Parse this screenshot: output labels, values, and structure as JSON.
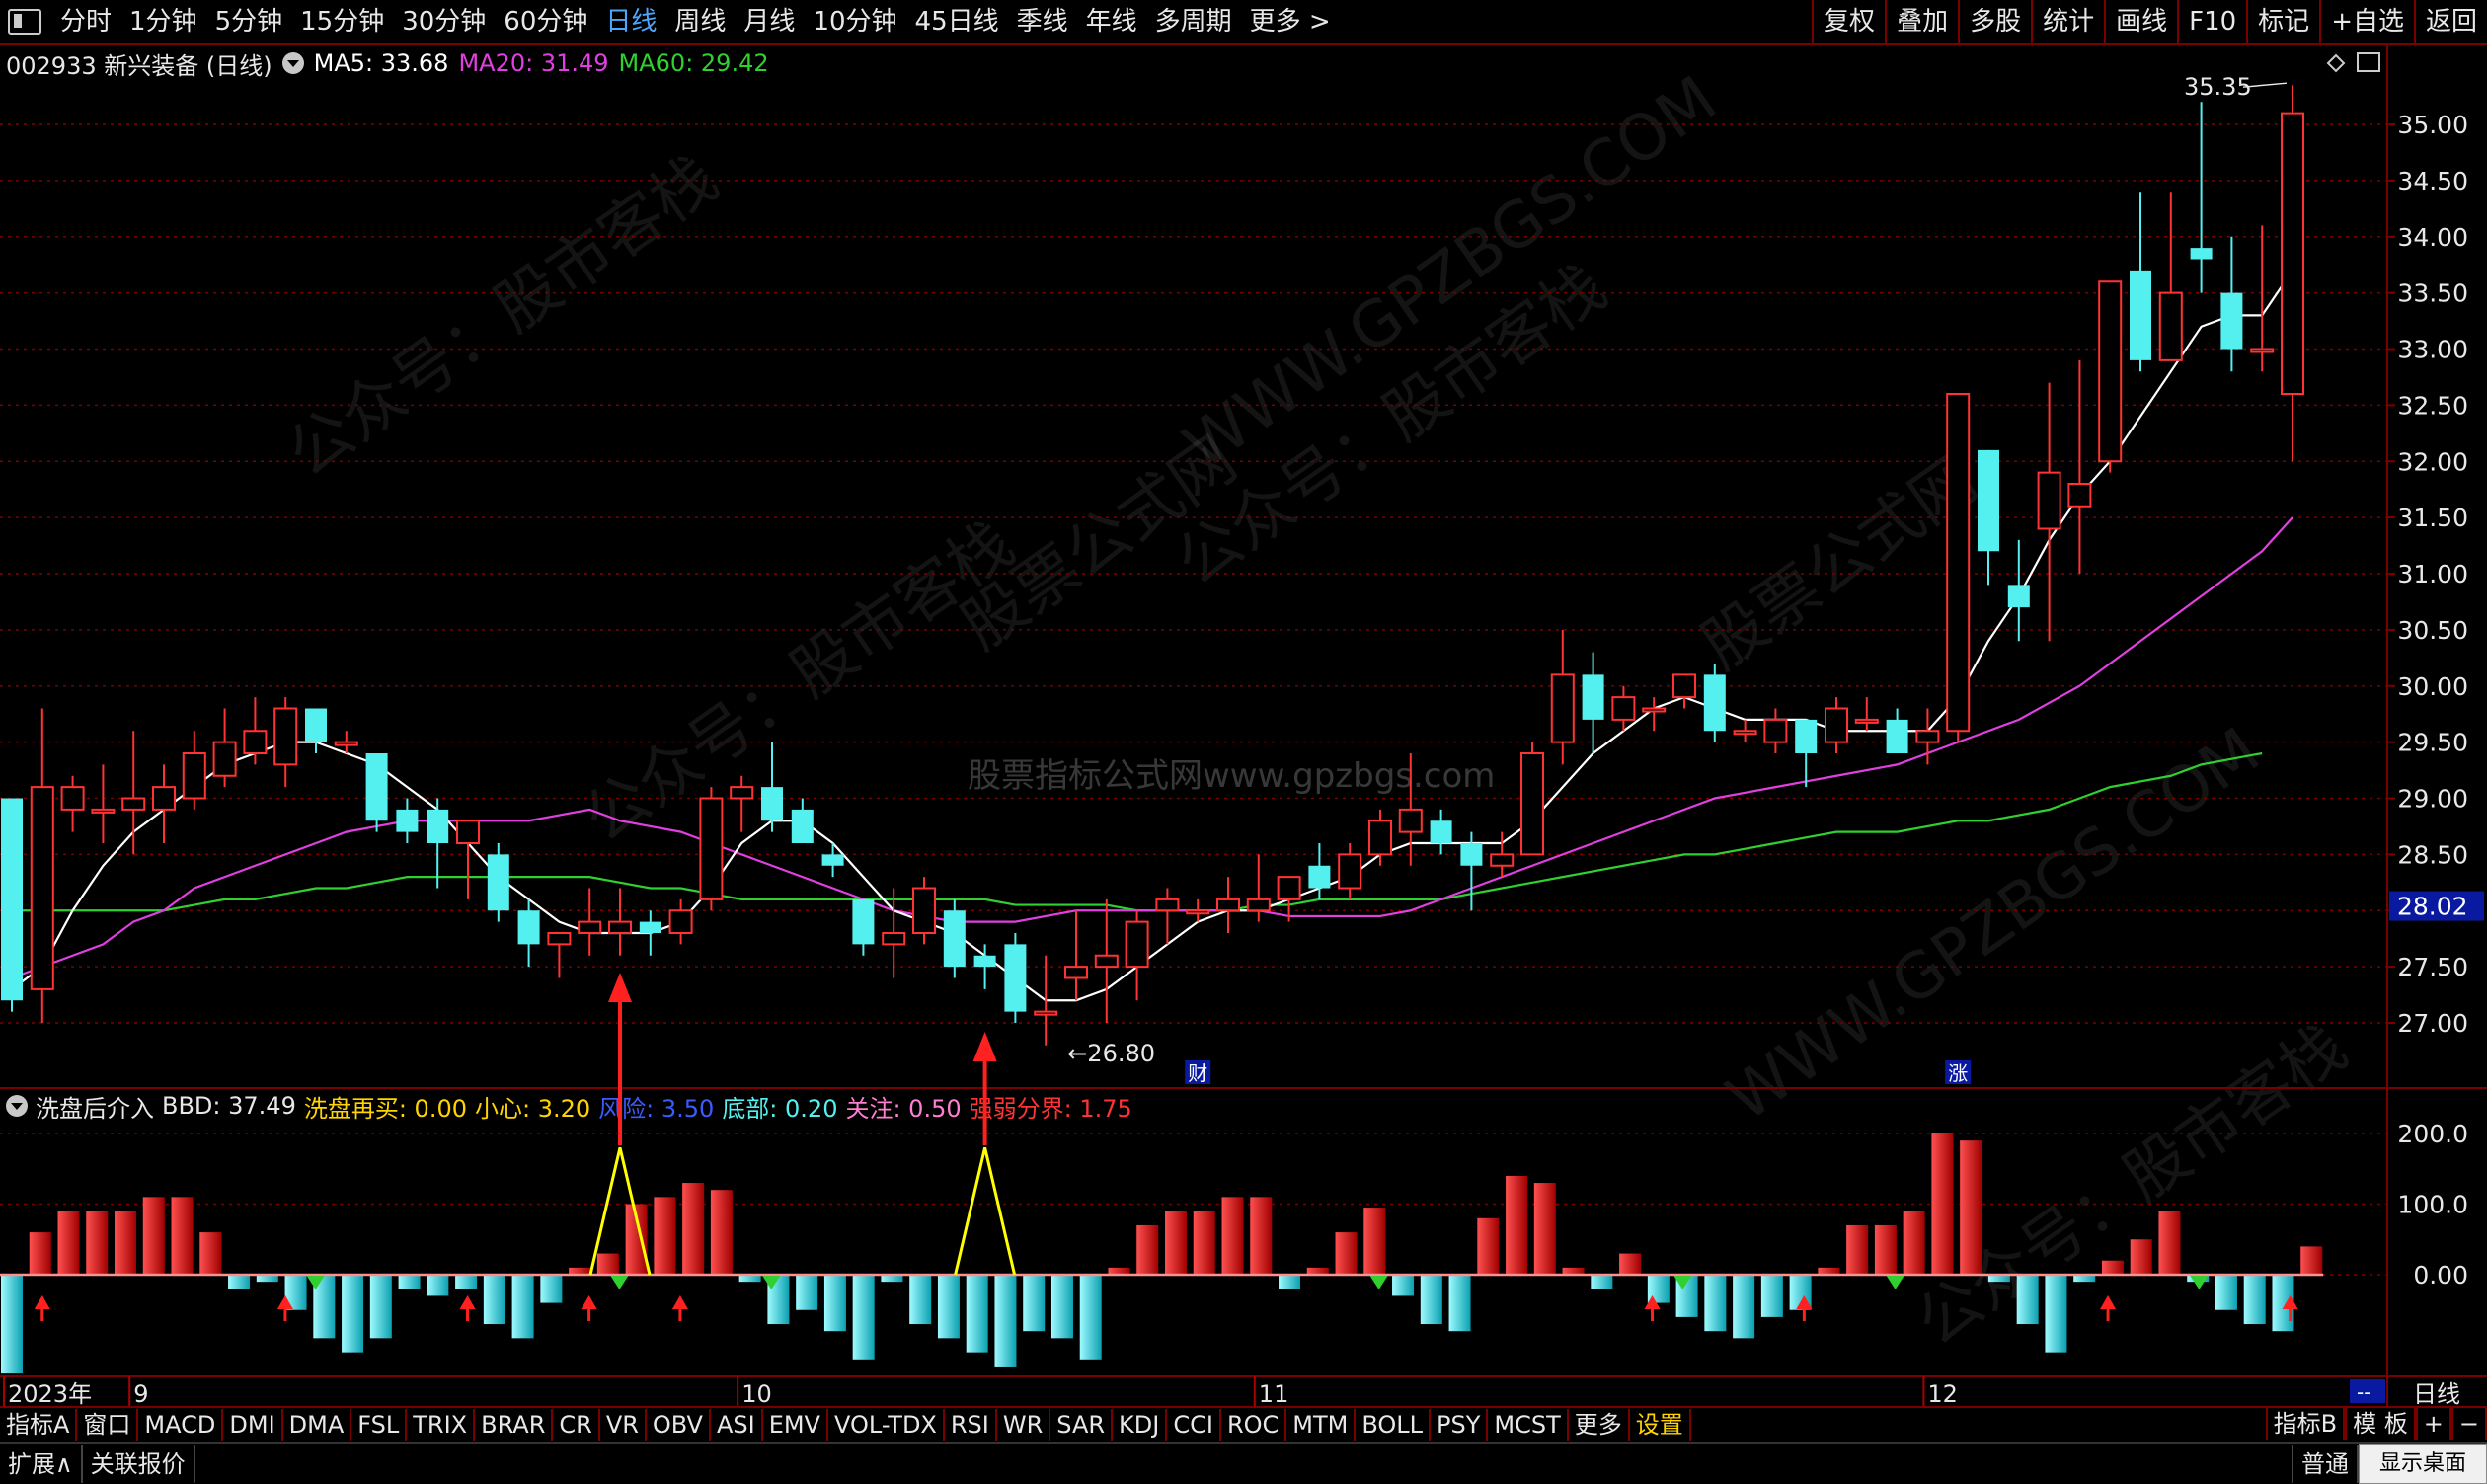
{
  "toolbar": {
    "periods": [
      "分时",
      "1分钟",
      "5分钟",
      "15分钟",
      "30分钟",
      "60分钟",
      "日线",
      "周线",
      "月线",
      "10分钟",
      "45日线",
      "季线",
      "年线",
      "多周期",
      "更多 >"
    ],
    "active_period": "日线",
    "right_items": [
      "复权",
      "叠加",
      "多股",
      "统计",
      "画线",
      "F10",
      "标记",
      "+自选",
      "返回"
    ]
  },
  "stock": {
    "code_name": "002933 新兴装备 (日线)",
    "ma5": "MA5: 33.68",
    "ma20": "MA20: 31.49",
    "ma60": "MA60: 29.42"
  },
  "indicator": {
    "name": "洗盘后介入",
    "bbd": "BBD: 37.49",
    "xpzm": "洗盘再买: 0.00",
    "xx": "小心: 3.20",
    "fx": "风险: 3.50",
    "db": "底部: 0.20",
    "gz": "关注: 0.50",
    "qrfj": "强弱分界: 1.75"
  },
  "colors": {
    "up": "#ff3333",
    "down": "#54f0f0",
    "ma5": "#ffffff",
    "ma20": "#e040e0",
    "ma60": "#30d030",
    "grid": "#7a0000",
    "axis_text": "#e8e8e8"
  },
  "chart_data": {
    "type": "candlestick",
    "price_axis": [
      27.0,
      27.5,
      28.0,
      28.5,
      29.0,
      29.5,
      30.0,
      30.5,
      31.0,
      31.5,
      32.0,
      32.5,
      33.0,
      33.5,
      34.0,
      34.5,
      35.0
    ],
    "price_axis_labels": [
      "27.00",
      "27.50",
      "28.00",
      "28.50",
      "29.00",
      "29.50",
      "30.00",
      "30.50",
      "31.00",
      "31.50",
      "32.00",
      "32.50",
      "33.00",
      "33.50",
      "34.00",
      "34.50",
      "35.00"
    ],
    "current_price_label": "28.02",
    "max_label": "35.35",
    "min_label": "26.80",
    "markers": [
      {
        "text": "财",
        "index": 39
      },
      {
        "text": "涨",
        "index": 64
      }
    ],
    "candles": [
      {
        "o": 29.0,
        "h": 29.0,
        "l": 27.1,
        "c": 27.2
      },
      {
        "o": 27.3,
        "h": 29.8,
        "l": 27.0,
        "c": 29.1
      },
      {
        "o": 28.9,
        "h": 29.2,
        "l": 28.7,
        "c": 29.1
      },
      {
        "o": 28.9,
        "h": 29.3,
        "l": 28.6,
        "c": 28.9
      },
      {
        "o": 28.9,
        "h": 29.6,
        "l": 28.5,
        "c": 29.0
      },
      {
        "o": 28.9,
        "h": 29.3,
        "l": 28.6,
        "c": 29.1
      },
      {
        "o": 29.0,
        "h": 29.6,
        "l": 28.9,
        "c": 29.4
      },
      {
        "o": 29.2,
        "h": 29.8,
        "l": 29.1,
        "c": 29.5
      },
      {
        "o": 29.4,
        "h": 29.9,
        "l": 29.3,
        "c": 29.6
      },
      {
        "o": 29.3,
        "h": 29.9,
        "l": 29.1,
        "c": 29.8
      },
      {
        "o": 29.8,
        "h": 29.8,
        "l": 29.4,
        "c": 29.5
      },
      {
        "o": 29.5,
        "h": 29.6,
        "l": 29.4,
        "c": 29.5
      },
      {
        "o": 29.4,
        "h": 29.4,
        "l": 28.7,
        "c": 28.8
      },
      {
        "o": 28.9,
        "h": 29.0,
        "l": 28.6,
        "c": 28.7
      },
      {
        "o": 28.9,
        "h": 29.0,
        "l": 28.2,
        "c": 28.6
      },
      {
        "o": 28.6,
        "h": 28.8,
        "l": 28.1,
        "c": 28.8
      },
      {
        "o": 28.5,
        "h": 28.6,
        "l": 27.9,
        "c": 28.0
      },
      {
        "o": 28.0,
        "h": 28.1,
        "l": 27.5,
        "c": 27.7
      },
      {
        "o": 27.7,
        "h": 27.8,
        "l": 27.4,
        "c": 27.8
      },
      {
        "o": 27.8,
        "h": 28.2,
        "l": 27.6,
        "c": 27.9
      },
      {
        "o": 27.8,
        "h": 28.2,
        "l": 27.6,
        "c": 27.9
      },
      {
        "o": 27.9,
        "h": 28.0,
        "l": 27.6,
        "c": 27.8
      },
      {
        "o": 27.8,
        "h": 28.1,
        "l": 27.7,
        "c": 28.0
      },
      {
        "o": 28.1,
        "h": 29.1,
        "l": 28.0,
        "c": 29.0
      },
      {
        "o": 29.0,
        "h": 29.2,
        "l": 28.7,
        "c": 29.1
      },
      {
        "o": 29.1,
        "h": 29.5,
        "l": 28.7,
        "c": 28.8
      },
      {
        "o": 28.9,
        "h": 29.0,
        "l": 28.6,
        "c": 28.6
      },
      {
        "o": 28.5,
        "h": 28.6,
        "l": 28.3,
        "c": 28.4
      },
      {
        "o": 28.1,
        "h": 28.1,
        "l": 27.6,
        "c": 27.7
      },
      {
        "o": 27.7,
        "h": 28.2,
        "l": 27.4,
        "c": 27.8
      },
      {
        "o": 27.8,
        "h": 28.3,
        "l": 27.7,
        "c": 28.2
      },
      {
        "o": 28.0,
        "h": 28.1,
        "l": 27.4,
        "c": 27.5
      },
      {
        "o": 27.6,
        "h": 27.7,
        "l": 27.3,
        "c": 27.5
      },
      {
        "o": 27.7,
        "h": 27.8,
        "l": 27.0,
        "c": 27.1
      },
      {
        "o": 27.1,
        "h": 27.6,
        "l": 26.8,
        "c": 27.1
      },
      {
        "o": 27.4,
        "h": 28.0,
        "l": 27.2,
        "c": 27.5
      },
      {
        "o": 27.5,
        "h": 28.1,
        "l": 27.0,
        "c": 27.6
      },
      {
        "o": 27.5,
        "h": 28.0,
        "l": 27.2,
        "c": 27.9
      },
      {
        "o": 28.0,
        "h": 28.2,
        "l": 27.7,
        "c": 28.1
      },
      {
        "o": 28.0,
        "h": 28.1,
        "l": 27.9,
        "c": 28.0
      },
      {
        "o": 28.0,
        "h": 28.3,
        "l": 27.8,
        "c": 28.1
      },
      {
        "o": 28.0,
        "h": 28.5,
        "l": 27.9,
        "c": 28.1
      },
      {
        "o": 28.1,
        "h": 28.3,
        "l": 27.9,
        "c": 28.3
      },
      {
        "o": 28.4,
        "h": 28.6,
        "l": 28.1,
        "c": 28.2
      },
      {
        "o": 28.2,
        "h": 28.6,
        "l": 28.1,
        "c": 28.5
      },
      {
        "o": 28.5,
        "h": 28.9,
        "l": 28.4,
        "c": 28.8
      },
      {
        "o": 28.7,
        "h": 29.4,
        "l": 28.4,
        "c": 28.9
      },
      {
        "o": 28.8,
        "h": 28.9,
        "l": 28.5,
        "c": 28.6
      },
      {
        "o": 28.6,
        "h": 28.7,
        "l": 28.0,
        "c": 28.4
      },
      {
        "o": 28.4,
        "h": 28.7,
        "l": 28.3,
        "c": 28.5
      },
      {
        "o": 28.5,
        "h": 29.5,
        "l": 28.5,
        "c": 29.4
      },
      {
        "o": 29.5,
        "h": 30.5,
        "l": 29.3,
        "c": 30.1
      },
      {
        "o": 30.1,
        "h": 30.3,
        "l": 29.4,
        "c": 29.7
      },
      {
        "o": 29.7,
        "h": 30.0,
        "l": 29.6,
        "c": 29.9
      },
      {
        "o": 29.8,
        "h": 29.9,
        "l": 29.6,
        "c": 29.8
      },
      {
        "o": 29.9,
        "h": 30.1,
        "l": 29.8,
        "c": 30.1
      },
      {
        "o": 30.1,
        "h": 30.2,
        "l": 29.5,
        "c": 29.6
      },
      {
        "o": 29.6,
        "h": 29.7,
        "l": 29.5,
        "c": 29.6
      },
      {
        "o": 29.5,
        "h": 29.8,
        "l": 29.4,
        "c": 29.7
      },
      {
        "o": 29.7,
        "h": 29.7,
        "l": 29.1,
        "c": 29.4
      },
      {
        "o": 29.5,
        "h": 29.9,
        "l": 29.4,
        "c": 29.8
      },
      {
        "o": 29.7,
        "h": 29.9,
        "l": 29.6,
        "c": 29.7
      },
      {
        "o": 29.7,
        "h": 29.8,
        "l": 29.5,
        "c": 29.4
      },
      {
        "o": 29.5,
        "h": 29.8,
        "l": 29.3,
        "c": 29.6
      },
      {
        "o": 29.6,
        "h": 32.6,
        "l": 29.5,
        "c": 32.6
      },
      {
        "o": 32.1,
        "h": 32.1,
        "l": 30.9,
        "c": 31.2
      },
      {
        "o": 30.9,
        "h": 31.3,
        "l": 30.4,
        "c": 30.7
      },
      {
        "o": 31.4,
        "h": 32.7,
        "l": 30.4,
        "c": 31.9
      },
      {
        "o": 31.6,
        "h": 32.9,
        "l": 31.0,
        "c": 31.8
      },
      {
        "o": 32.0,
        "h": 33.5,
        "l": 31.9,
        "c": 33.6
      },
      {
        "o": 33.7,
        "h": 34.4,
        "l": 32.8,
        "c": 32.9
      },
      {
        "o": 32.9,
        "h": 34.4,
        "l": 32.9,
        "c": 33.5
      },
      {
        "o": 33.9,
        "h": 35.2,
        "l": 33.5,
        "c": 33.8
      },
      {
        "o": 33.5,
        "h": 34.0,
        "l": 32.8,
        "c": 33.0
      },
      {
        "o": 33.0,
        "h": 34.1,
        "l": 32.8,
        "c": 33.0
      },
      {
        "o": 32.6,
        "h": 35.35,
        "l": 32.0,
        "c": 35.1
      }
    ],
    "ma5_values": [
      27.3,
      27.5,
      28.0,
      28.4,
      28.7,
      28.9,
      29.1,
      29.3,
      29.4,
      29.5,
      29.5,
      29.4,
      29.3,
      29.1,
      28.9,
      28.6,
      28.3,
      28.1,
      27.9,
      27.8,
      27.8,
      27.8,
      27.9,
      28.2,
      28.6,
      28.8,
      28.8,
      28.6,
      28.3,
      28.0,
      27.9,
      27.8,
      27.6,
      27.4,
      27.2,
      27.2,
      27.3,
      27.5,
      27.7,
      27.9,
      28.0,
      28.0,
      28.1,
      28.2,
      28.3,
      28.5,
      28.6,
      28.6,
      28.6,
      28.6,
      28.8,
      29.1,
      29.4,
      29.6,
      29.8,
      29.9,
      29.8,
      29.7,
      29.7,
      29.7,
      29.6,
      29.6,
      29.6,
      29.6,
      29.9,
      30.4,
      30.8,
      31.3,
      31.7,
      32.0,
      32.4,
      32.8,
      33.2,
      33.3,
      33.3,
      33.7
    ],
    "ma20_values": [
      27.4,
      27.5,
      27.6,
      27.7,
      27.9,
      28.0,
      28.2,
      28.3,
      28.4,
      28.5,
      28.6,
      28.7,
      28.75,
      28.8,
      28.8,
      28.8,
      28.8,
      28.8,
      28.85,
      28.9,
      28.8,
      28.75,
      28.7,
      28.6,
      28.5,
      28.4,
      28.3,
      28.2,
      28.1,
      28.0,
      27.95,
      27.9,
      27.9,
      27.9,
      27.95,
      28.0,
      28.0,
      28.0,
      28.0,
      28.0,
      28.0,
      28.0,
      27.95,
      27.95,
      27.95,
      27.95,
      28.0,
      28.1,
      28.2,
      28.3,
      28.4,
      28.5,
      28.6,
      28.7,
      28.8,
      28.9,
      29.0,
      29.05,
      29.1,
      29.15,
      29.2,
      29.25,
      29.3,
      29.4,
      29.5,
      29.6,
      29.7,
      29.85,
      30.0,
      30.2,
      30.4,
      30.6,
      30.8,
      31.0,
      31.2,
      31.5
    ],
    "ma60_values": [
      28.0,
      28.0,
      28.0,
      28.0,
      28.0,
      28.0,
      28.05,
      28.1,
      28.1,
      28.15,
      28.2,
      28.2,
      28.25,
      28.3,
      28.3,
      28.3,
      28.3,
      28.3,
      28.3,
      28.3,
      28.25,
      28.2,
      28.2,
      28.15,
      28.1,
      28.1,
      28.1,
      28.1,
      28.1,
      28.1,
      28.1,
      28.1,
      28.1,
      28.05,
      28.05,
      28.05,
      28.05,
      28.0,
      28.0,
      28.0,
      28.0,
      28.05,
      28.05,
      28.1,
      28.1,
      28.1,
      28.1,
      28.1,
      28.15,
      28.2,
      28.25,
      28.3,
      28.35,
      28.4,
      28.45,
      28.5,
      28.5,
      28.55,
      28.6,
      28.65,
      28.7,
      28.7,
      28.7,
      28.75,
      28.8,
      28.8,
      28.85,
      28.9,
      29.0,
      29.1,
      29.15,
      29.2,
      29.3,
      29.35,
      29.4
    ],
    "osc_axis_labels": [
      "200.0",
      "100.0",
      "0.00"
    ],
    "osc_axis_values": [
      200,
      100,
      0
    ],
    "osc_values": [
      -140,
      60,
      90,
      90,
      90,
      110,
      110,
      60,
      -20,
      -10,
      -50,
      -90,
      -110,
      -90,
      -20,
      -30,
      -20,
      -70,
      -90,
      -40,
      10,
      30,
      100,
      110,
      130,
      120,
      -10,
      -70,
      -50,
      -80,
      -120,
      -10,
      -70,
      -90,
      -110,
      -130,
      -80,
      -90,
      -120,
      10,
      70,
      90,
      90,
      110,
      110,
      -20,
      10,
      60,
      95,
      -30,
      -70,
      -80,
      80,
      140,
      130,
      10,
      -20,
      30,
      -40,
      -60,
      -80,
      -90,
      -60,
      -50,
      10,
      70,
      70,
      90,
      200,
      190,
      -10,
      -70,
      -110,
      -10,
      20,
      50,
      90,
      -10,
      -50,
      -70,
      -80,
      40
    ],
    "yellow_spikes": [
      20,
      32
    ],
    "red_spike_arrows": [
      20,
      32
    ],
    "small_up_arrows": [
      1,
      9,
      15,
      19,
      22,
      54,
      59,
      69,
      75
    ],
    "small_down_arrows": [
      10,
      20,
      25,
      45,
      55,
      62,
      72
    ],
    "x_labels": [
      {
        "text": "2023年",
        "index": 0.5
      },
      {
        "text": "9",
        "index": 4
      },
      {
        "text": "10",
        "index": 24
      },
      {
        "text": "11",
        "index": 41
      },
      {
        "text": "12",
        "index": 63
      }
    ]
  },
  "bottom_tabs": [
    "指标A",
    "窗口",
    "MACD",
    "DMI",
    "DMA",
    "FSL",
    "TRIX",
    "BRAR",
    "CR",
    "VR",
    "OBV",
    "ASI",
    "EMV",
    "VOL-TDX",
    "RSI",
    "WR",
    "SAR",
    "KDJ",
    "CCI",
    "ROC",
    "MTM",
    "BOLL",
    "PSY",
    "MCST",
    "更多",
    "设置"
  ],
  "bottom_right": [
    "指标B",
    "模 板",
    "+",
    "−"
  ],
  "timeline_right": [
    "--",
    "日线"
  ],
  "status": [
    "扩展∧",
    "关联报价",
    "普通"
  ],
  "desktop_tip": "显示桌面",
  "watermarks": [
    "公众号：股市客栈",
    "WWW.GPZBGS.COM",
    "股票公式网",
    "股票指标公式网www.gpzbgs.com"
  ]
}
